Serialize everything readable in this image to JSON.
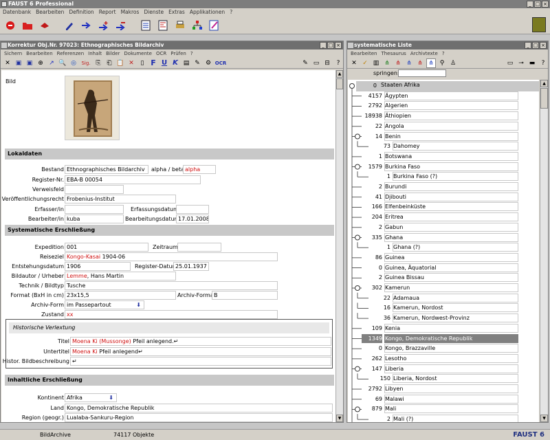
{
  "app": {
    "title": "FAUST 6 Professional",
    "menu": [
      "Datenbank",
      "Bearbeiten",
      "Definition",
      "Report",
      "Makros",
      "Dienste",
      "Extras",
      "Applikationen",
      "?"
    ]
  },
  "left": {
    "title": "Korrektur Obj.Nr. 97023: Ethnographisches Bildarchiv",
    "menu": [
      "Sichern",
      "Bearbeiten",
      "Referenzen",
      "Inhalt",
      "Bilder",
      "Dokumente",
      "OCR",
      "Prüfen",
      "?"
    ],
    "tool_labels": {
      "sig": "Sig.",
      "ocr": "OCR",
      "bold": "F",
      "underline": "U",
      "italic": "K"
    },
    "bild_label": "Bild",
    "sections": {
      "lokal": "Lokaldaten",
      "syst": "Systematische Erschließung",
      "hist": "Historische Verlextung",
      "inhalt": "Inhaltliche Erschließung"
    },
    "fields": {
      "bestand_l": "Bestand",
      "bestand": "Ethnographisches Bildarchiv",
      "alpha_l": "alpha / beta",
      "alpha": "alpha",
      "regnr_l": "Register-Nr.",
      "regnr": "EBA-B 00054",
      "verweis_l": "Verweisfeld",
      "recht_l": "Veröffentlichungsrecht",
      "recht": "Frobenius-Institut",
      "erfasser_l": "Erfasser/in",
      "erfdatum_l": "Erfassungsdatum",
      "bearb_l": "Bearbeiter/in",
      "bearb": "kuba",
      "bearbdatum_l": "Bearbeitungsdatum",
      "bearbdatum": "17.01.2008",
      "exp_l": "Expedition",
      "exp": "001",
      "zeitraum_l": "Zeitraum",
      "reise_l": "Reiseziel",
      "reise_red": "Kongo-Kasai",
      "reise_rest": " 1904-06",
      "entst_l": "Entstehungsdatum",
      "entst": "1906",
      "regdat_l": "Register-Datum",
      "regdat": "25.01.1937",
      "autor_l": "Bildautor / Urheber",
      "autor_red": "Lemme",
      "autor_rest": ", Hans Martin",
      "technik_l": "Technik / Bildtyp",
      "technik": "Tusche",
      "format_l": "Format (BxH in cm)",
      "format": "23x15,5",
      "aformat_l": "Archiv-Format",
      "aformat": "B",
      "aform_l": "Archiv-Form",
      "aform": "im Passepartout",
      "zustand_l": "Zustand",
      "zustand": "xx",
      "titel_l": "Titel",
      "titel_red": "Moena Ki (Mussonge)",
      "titel_rest": " Pfeil anlegend.↵",
      "untertitel_l": "Untertitel",
      "untertitel_red": "Moena Ki",
      "untertitel_rest": " Pfeil anlegend↵",
      "histbeschr_l": "Histor. Bildbeschreibung",
      "histbeschr": "↵",
      "kont_l": "Kontinent",
      "kont": "Afrika",
      "land_l": "Land",
      "land": "Kongo, Demokratische Republik",
      "region_l": "Region (geogr.)",
      "region": "Lualaba-Sankuru-Region"
    }
  },
  "right": {
    "title": "systematische Liste",
    "menu": [
      "Bearbeiten",
      "Thesaurus",
      "Archivtexte",
      "?"
    ],
    "springen": "springen:",
    "items": [
      {
        "n": "0",
        "t": "Staaten Afrika",
        "lvl": 0,
        "root": true
      },
      {
        "n": "4157",
        "t": "Ägypten",
        "lvl": 1
      },
      {
        "n": "2792",
        "t": "Algerien",
        "lvl": 1
      },
      {
        "n": "18938",
        "t": "Äthiopien",
        "lvl": 1
      },
      {
        "n": "22",
        "t": "Angola",
        "lvl": 1
      },
      {
        "n": "14",
        "t": "Benin",
        "lvl": 1,
        "o": true
      },
      {
        "n": "73",
        "t": "Dahomey",
        "lvl": 2
      },
      {
        "n": "1",
        "t": "Botswana",
        "lvl": 1
      },
      {
        "n": "1579",
        "t": "Burkina Faso",
        "lvl": 1,
        "o": true
      },
      {
        "n": "1",
        "t": "Burkina Faso (?)",
        "lvl": 2
      },
      {
        "n": "2",
        "t": "Burundi",
        "lvl": 1
      },
      {
        "n": "41",
        "t": "Djibouti",
        "lvl": 1
      },
      {
        "n": "166",
        "t": "Elfenbeinküste",
        "lvl": 1
      },
      {
        "n": "204",
        "t": "Eritrea",
        "lvl": 1
      },
      {
        "n": "2",
        "t": "Gabun",
        "lvl": 1
      },
      {
        "n": "335",
        "t": "Ghana",
        "lvl": 1,
        "o": true
      },
      {
        "n": "1",
        "t": "Ghana (?)",
        "lvl": 2
      },
      {
        "n": "86",
        "t": "Guinea",
        "lvl": 1
      },
      {
        "n": "0",
        "t": "Guinea, Äquatorial",
        "lvl": 1
      },
      {
        "n": "2",
        "t": "Guinea Bissau",
        "lvl": 1
      },
      {
        "n": "302",
        "t": "Kamerun",
        "lvl": 1,
        "o": true
      },
      {
        "n": "22",
        "t": "Adamaua",
        "lvl": 2
      },
      {
        "n": "16",
        "t": "Kamerun, Nordost",
        "lvl": 2
      },
      {
        "n": "36",
        "t": "Kamerun, Nordwest-Provinz",
        "lvl": 2
      },
      {
        "n": "109",
        "t": "Kenia",
        "lvl": 1
      },
      {
        "n": "1349",
        "t": "Kongo, Demokratische Republik",
        "lvl": 1,
        "sel": true
      },
      {
        "n": "0",
        "t": "Kongo, Brazzaville",
        "lvl": 1
      },
      {
        "n": "262",
        "t": "Lesotho",
        "lvl": 1
      },
      {
        "n": "147",
        "t": "Liberia",
        "lvl": 1,
        "o": true
      },
      {
        "n": "150",
        "t": "Liberia, Nordost",
        "lvl": 2
      },
      {
        "n": "2792",
        "t": "Libyen",
        "lvl": 1
      },
      {
        "n": "69",
        "t": "Malawi",
        "lvl": 1
      },
      {
        "n": "879",
        "t": "Mali",
        "lvl": 1,
        "o": true
      },
      {
        "n": "2",
        "t": "Mali (?)",
        "lvl": 2
      }
    ]
  },
  "status": {
    "db": "BildArchive",
    "count": "74117 Objekte",
    "brand": "FAUST 6"
  }
}
